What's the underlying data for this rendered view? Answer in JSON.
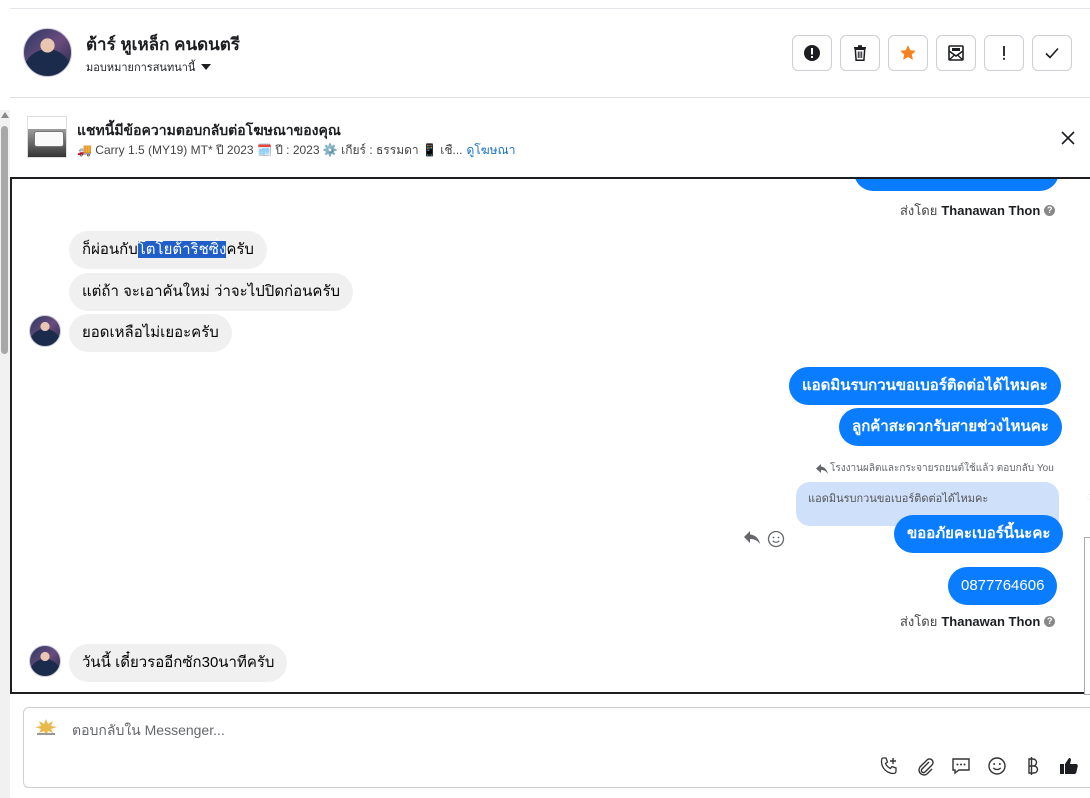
{
  "header": {
    "name": "ต้าร์ หูเหล็ก คนดนตรี",
    "assign_label": "มอบหมายการสนทนานี้"
  },
  "ad": {
    "title": "แชทนี้มีข้อความตอบกลับต่อโฆษณาของคุณ",
    "desc": "🚚 Carry 1.5 (MY19) MT* ปี 2023 🗓️ ปี : 2023 ⚙️ เกียร์ : ธรรมดา 📱 เชื...",
    "link": "ดูโฆษณา"
  },
  "messages": {
    "sent_by_prefix": "ส่งโดย",
    "sender": "Thanawan Thon",
    "in1_before": "ก็ผ่อนกับ",
    "in1_highlight": "โตโยต้าริชซิ่ง",
    "in1_after": "ครับ",
    "in2": "แต่ถ้า จะเอาคันใหม่ ว่าจะไปปิดก่อนครับ",
    "in3": "ยอดเหลือไม่เยอะครับ",
    "out1": "แอดมินรบกวนขอเบอร์ติดต่อได้ไหมคะ",
    "out2": "ลูกค้าสะดวกรับสายช่วงไหนคะ",
    "reply_context": "โรงงานผลิตและกระจายรถยนต์ใช้แล้ว ตอบกลับ You",
    "quoted": "แอดมินรบกวนขอเบอร์ติดต่อได้ไหมคะ",
    "out3": "ขออภัยคะเบอร์นี้นะคะ",
    "out4": "0877764606",
    "in4": "วันนี้ เดี๋ยวรออีกซัก30นาทีครับ"
  },
  "composer": {
    "placeholder": "ตอบกลับใน Messenger..."
  },
  "colors": {
    "accent": "#0a7cff",
    "incoming": "#f0f0f0",
    "star": "#f5821f"
  }
}
